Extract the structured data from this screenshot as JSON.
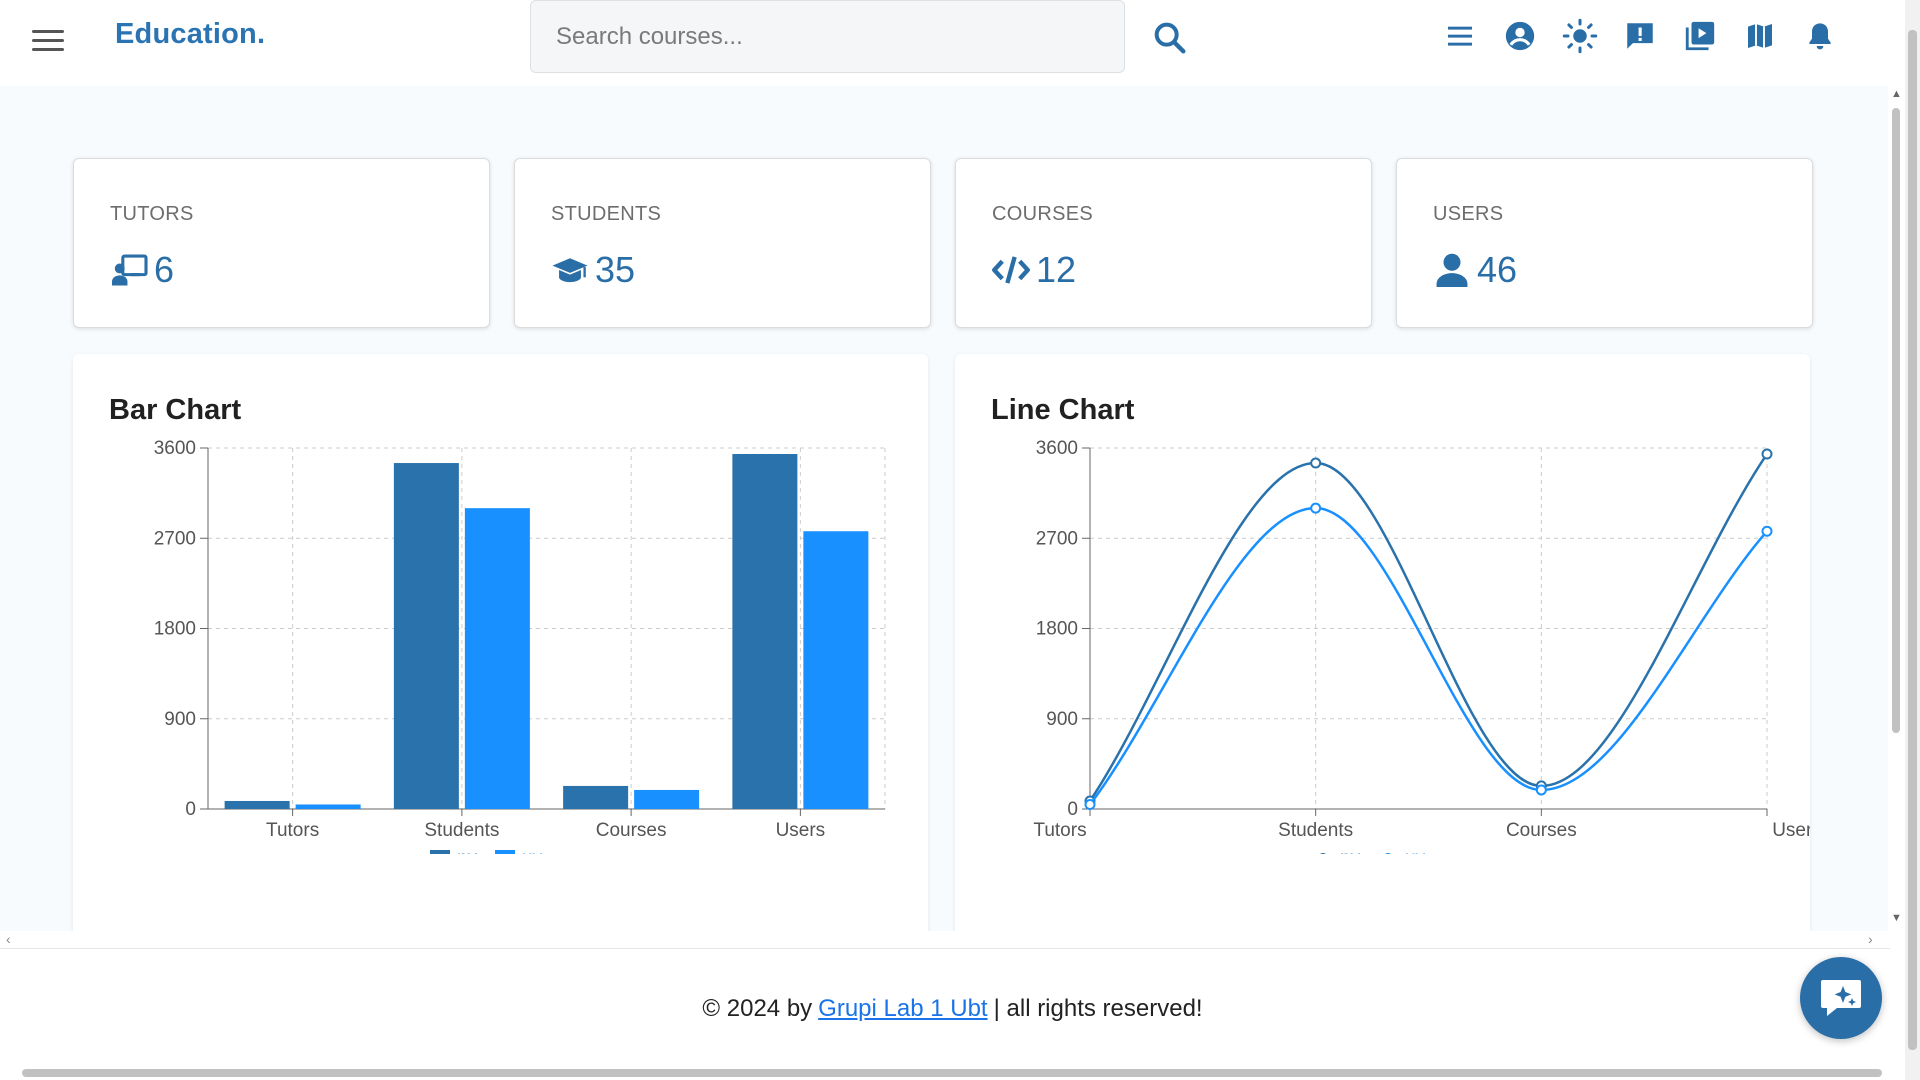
{
  "header": {
    "brand": "Education.",
    "search_placeholder": "Search courses...",
    "icons": [
      "menu-lines-icon",
      "account-circle-icon",
      "theme-sun-icon",
      "feedback-icon",
      "video-library-icon",
      "map-icon",
      "notification-bell-icon"
    ]
  },
  "stats": [
    {
      "label": "TUTORS",
      "value": "6",
      "icon": "tutor-icon"
    },
    {
      "label": "STUDENTS",
      "value": "35",
      "icon": "graduation-cap-icon"
    },
    {
      "label": "COURSES",
      "value": "12",
      "icon": "code-icon"
    },
    {
      "label": "USERS",
      "value": "46",
      "icon": "user-icon"
    }
  ],
  "charts": {
    "bar_title": "Bar Chart",
    "line_title": "Line Chart"
  },
  "chart_data": [
    {
      "type": "bar",
      "title": "Bar Chart",
      "categories": [
        "Tutors",
        "Students",
        "Courses",
        "Users"
      ],
      "series": [
        {
          "name": "pv",
          "values": [
            80,
            3450,
            230,
            3540
          ]
        },
        {
          "name": "uv",
          "values": [
            45,
            3000,
            190,
            2770
          ]
        }
      ],
      "yticks": [
        "0",
        "900",
        "1800",
        "2700",
        "3600"
      ],
      "ylim": [
        0,
        3600
      ],
      "grid": true,
      "legend": "bottom-center",
      "colors": {
        "pv": "#2a72ab",
        "uv": "#1890ff"
      }
    },
    {
      "type": "line",
      "title": "Line Chart",
      "categories": [
        "Tutors",
        "Students",
        "Courses",
        "Users"
      ],
      "series": [
        {
          "name": "pv",
          "values": [
            80,
            3450,
            230,
            3540
          ]
        },
        {
          "name": "uv",
          "values": [
            45,
            3000,
            190,
            2770
          ]
        }
      ],
      "yticks": [
        "0",
        "900",
        "1800",
        "2700",
        "3600"
      ],
      "ylim": [
        0,
        3600
      ],
      "grid": true,
      "legend": "bottom-center",
      "colors": {
        "pv": "#2a72ab",
        "uv": "#1890ff"
      }
    }
  ],
  "footer": {
    "prefix": "© 2024 by",
    "link": "Grupi Lab 1 Ubt",
    "suffix": "| all rights reserved!"
  }
}
